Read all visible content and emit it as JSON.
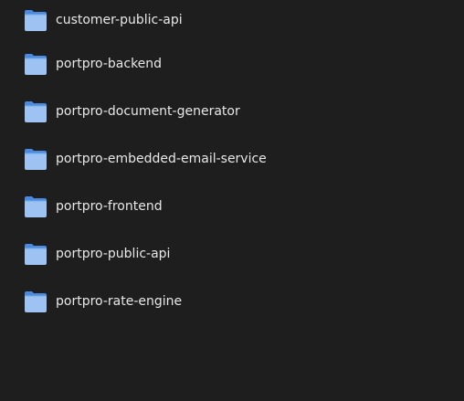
{
  "file_browser": {
    "folders": [
      {
        "name": "customer-public-api",
        "icon": "folder-icon"
      },
      {
        "name": "portpro-backend",
        "icon": "folder-icon"
      },
      {
        "name": "portpro-document-generator",
        "icon": "folder-icon"
      },
      {
        "name": "portpro-embedded-email-service",
        "icon": "folder-icon"
      },
      {
        "name": "portpro-frontend",
        "icon": "folder-icon"
      },
      {
        "name": "portpro-public-api",
        "icon": "folder-icon"
      },
      {
        "name": "portpro-rate-engine",
        "icon": "folder-icon"
      }
    ]
  },
  "colors": {
    "background": "#1e1e1e",
    "folder_back": "#4a8ae0",
    "folder_front": "#9ec3f2",
    "text": "#e8e8e8"
  }
}
